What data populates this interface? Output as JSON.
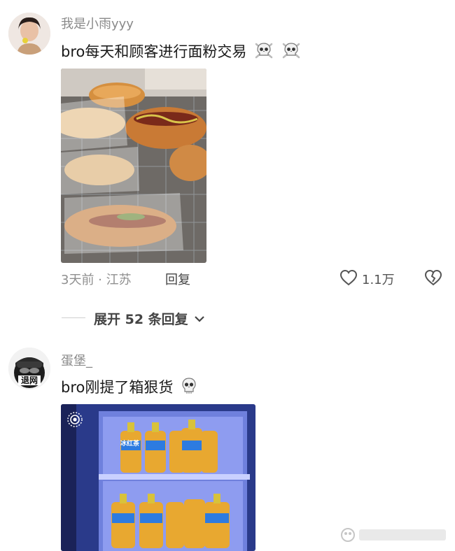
{
  "comments": [
    {
      "username": "我是小雨yyy",
      "text": "bro每天和顾客进行面粉交易",
      "time_location": "3天前 · 江苏",
      "reply_label": "回复",
      "likes": "1.1万"
    },
    {
      "username": "蛋堡_",
      "text": "bro刚提了箱狠货",
      "avatar_text": "退网"
    }
  ],
  "expand_replies_label": "展开 52 条回复",
  "fridge_bottle_label": "冰红茶",
  "colors": {
    "accent_text": "#1a1a1a",
    "muted": "#8a8a8a",
    "bread": "#d89a4a",
    "fridge_blue": "#5a6fd0"
  },
  "icons": [
    "skull-crossbones-icon",
    "skull-icon",
    "heart-icon",
    "broken-heart-icon",
    "chevron-down-icon",
    "live-photo-icon"
  ]
}
